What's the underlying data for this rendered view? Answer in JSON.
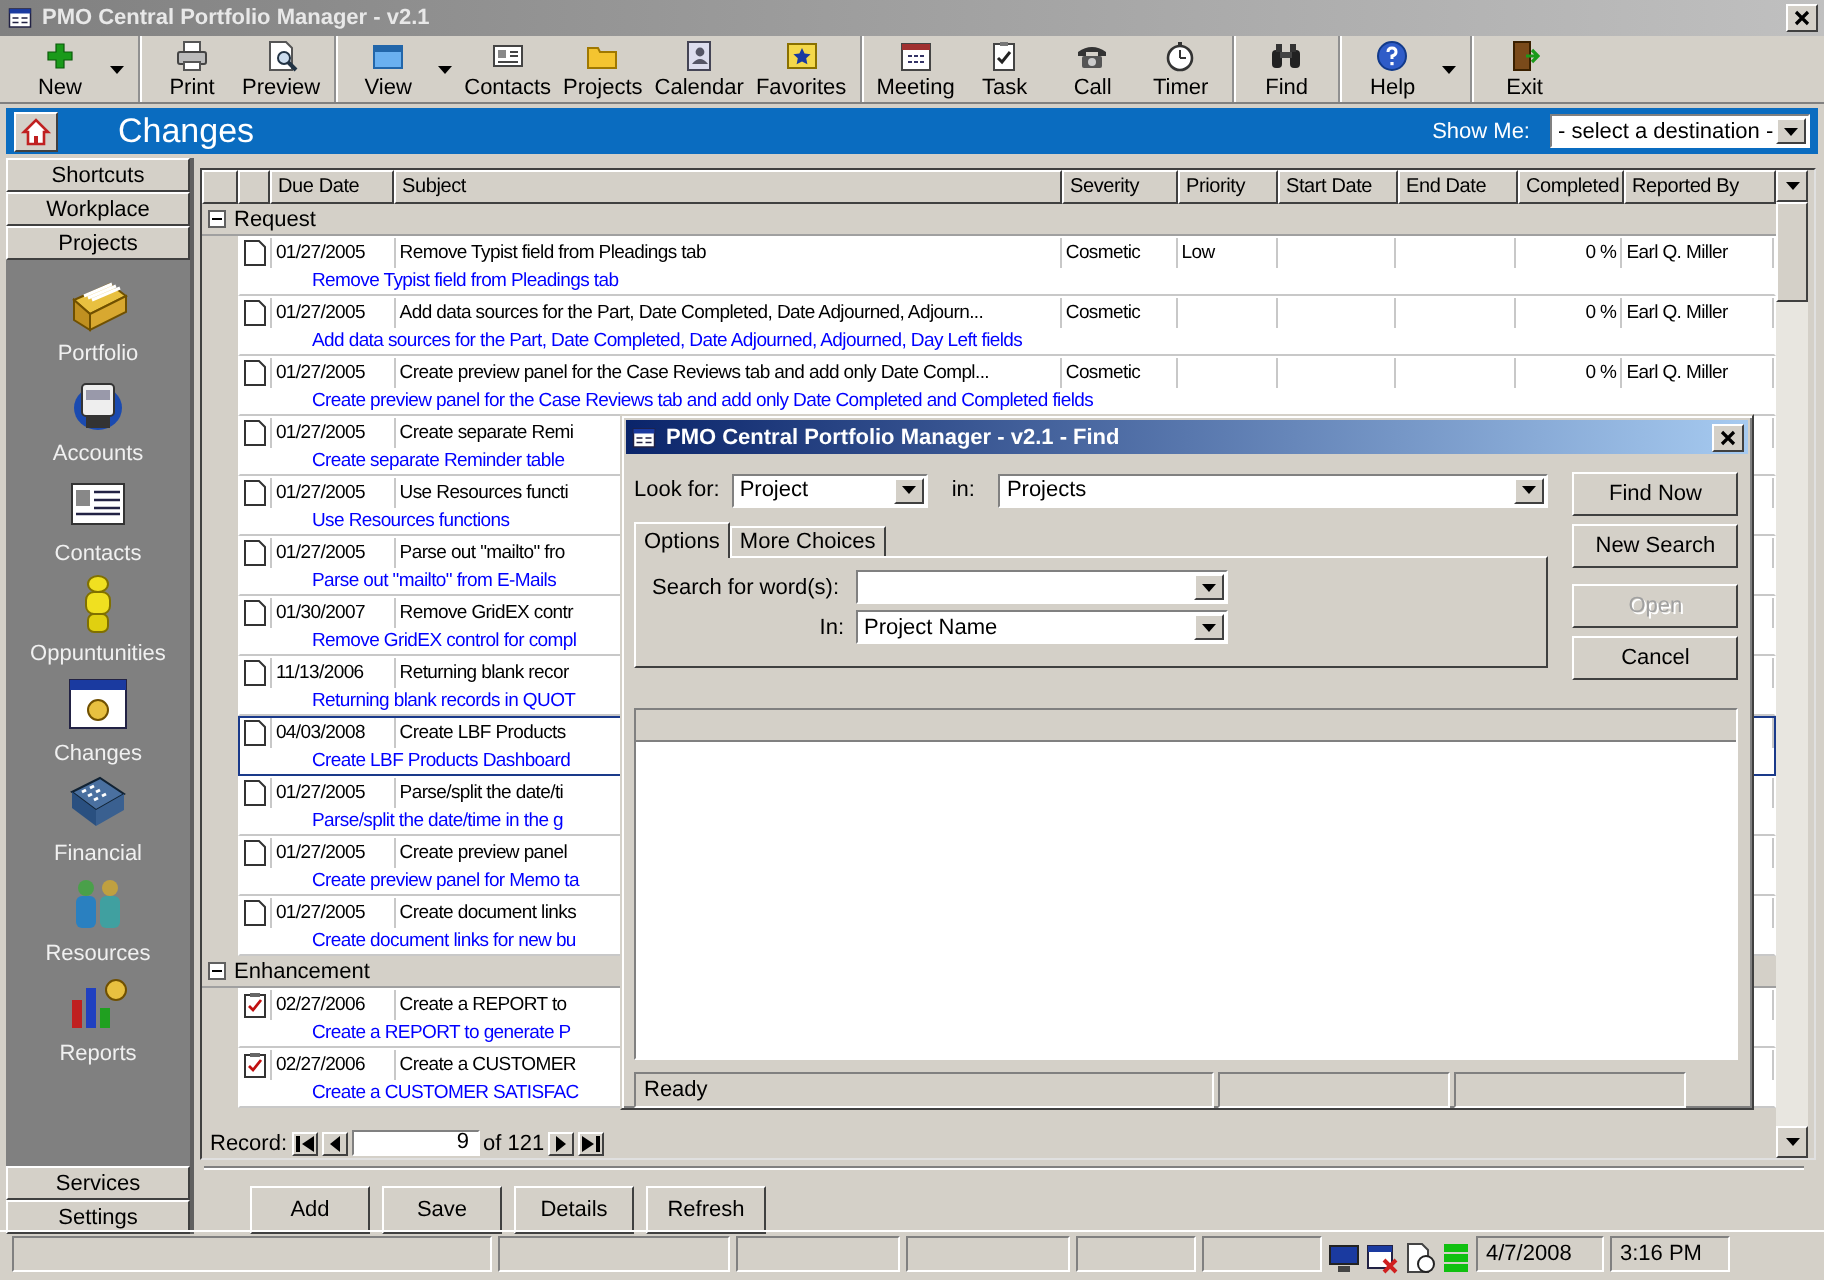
{
  "window": {
    "title": "PMO Central Portfolio Manager - v2.1"
  },
  "toolbar": [
    [
      {
        "label": "New",
        "dropdown": true
      }
    ],
    [
      {
        "label": "Print",
        "dropdown": false
      },
      {
        "label": "Preview",
        "dropdown": false
      }
    ],
    [
      {
        "label": "View",
        "dropdown": true
      },
      {
        "label": "Contacts",
        "dropdown": false
      },
      {
        "label": "Projects",
        "dropdown": false
      },
      {
        "label": "Calendar",
        "dropdown": false
      },
      {
        "label": "Favorites",
        "dropdown": false
      }
    ],
    [
      {
        "label": "Meeting",
        "dropdown": false
      },
      {
        "label": "Task",
        "dropdown": false
      },
      {
        "label": "Call",
        "dropdown": false
      },
      {
        "label": "Timer",
        "dropdown": false
      }
    ],
    [
      {
        "label": "Find",
        "dropdown": false
      }
    ],
    [
      {
        "label": "Help",
        "dropdown": true
      }
    ],
    [
      {
        "label": "Exit",
        "dropdown": false
      }
    ]
  ],
  "header": {
    "title": "Changes",
    "show_me_label": "Show Me:",
    "destination": "- select a destination -"
  },
  "sidebar": {
    "top_buttons": [
      "Shortcuts",
      "Workplace",
      "Projects"
    ],
    "items": [
      "Portfolio",
      "Accounts",
      "Contacts",
      "Oppuntunities",
      "Changes",
      "Financial",
      "Resources",
      "Reports"
    ],
    "bottom_buttons": [
      "Services",
      "Settings"
    ]
  },
  "grid": {
    "columns": [
      "Due Date",
      "Subject",
      "Severity",
      "Priority",
      "Start Date",
      "End Date",
      "Completed",
      "Reported By"
    ],
    "groups": [
      {
        "label": "Request",
        "expanded": true,
        "rows": [
          {
            "kind": "document",
            "selected": false,
            "due": "01/27/2005",
            "subject": "Remove Typist field from Pleadings tab",
            "severity": "Cosmetic",
            "priority": "Low",
            "completed": "0 %",
            "reported_by": "Earl Q. Miller",
            "description": "Remove Typist field from Pleadings tab"
          },
          {
            "kind": "document",
            "selected": false,
            "due": "01/27/2005",
            "subject": "Add data sources for the Part, Date Completed, Date Adjourned, Adjourn...",
            "severity": "Cosmetic",
            "completed": "0 %",
            "reported_by": "Earl Q. Miller",
            "description": "Add data sources for the Part, Date Completed, Date Adjourned, Adjourned, Day Left fields"
          },
          {
            "kind": "document",
            "selected": false,
            "due": "01/27/2005",
            "subject": "Create preview panel for the Case Reviews tab and add only Date Compl...",
            "severity": "Cosmetic",
            "completed": "0 %",
            "reported_by": "Earl Q. Miller",
            "description": "Create preview panel for the Case Reviews tab and add only Date Completed and Completed fields"
          },
          {
            "kind": "document",
            "selected": false,
            "due": "01/27/2005",
            "subject": "Create separate Remi",
            "description": "Create separate Reminder table"
          },
          {
            "kind": "document",
            "selected": false,
            "due": "01/27/2005",
            "subject": "Use Resources functi",
            "description": "Use Resources functions"
          },
          {
            "kind": "document",
            "selected": false,
            "due": "01/27/2005",
            "subject": "Parse out \"mailto\" fro",
            "description": "Parse out \"mailto\" from E-Mails"
          },
          {
            "kind": "document",
            "selected": false,
            "due": "01/30/2007",
            "subject": "Remove GridEX contr",
            "description": "Remove GridEX control for compl"
          },
          {
            "kind": "document",
            "selected": false,
            "due": "11/13/2006",
            "subject": "Returning blank recor",
            "description": "Returning blank records in QUOT"
          },
          {
            "kind": "document",
            "selected": true,
            "due": "04/03/2008",
            "subject": "Create LBF Products",
            "description": "Create LBF Products Dashboard"
          },
          {
            "kind": "document",
            "selected": false,
            "due": "01/27/2005",
            "subject": "Parse/split the date/ti",
            "description": "Parse/split the date/time in the g"
          },
          {
            "kind": "document",
            "selected": false,
            "due": "01/27/2005",
            "subject": "Create preview panel",
            "description": "Create preview panel for Memo ta"
          },
          {
            "kind": "document",
            "selected": false,
            "due": "01/27/2005",
            "subject": "Create document links",
            "description": "Create document links for new bu"
          }
        ]
      },
      {
        "label": "Enhancement",
        "expanded": true,
        "rows": [
          {
            "kind": "checklist",
            "selected": false,
            "due": "02/27/2006",
            "subject": "Create a REPORT to",
            "description": "Create a REPORT to generate P"
          },
          {
            "kind": "checklist",
            "selected": false,
            "due": "02/27/2006",
            "subject": "Create a CUSTOMER",
            "description": "Create a CUSTOMER SATISFAC"
          }
        ]
      }
    ]
  },
  "record_nav": {
    "label": "Record:",
    "current": "9",
    "total": "of 121"
  },
  "actions": [
    "Add",
    "Save",
    "Details",
    "Refresh"
  ],
  "find_dialog": {
    "title": "PMO Central Portfolio Manager - v2.1 - Find",
    "look_for_label": "Look for:",
    "look_for": "Project",
    "in_label": "in:",
    "in": "Projects",
    "tabs": [
      {
        "label": "Options",
        "selected": true
      },
      {
        "label": "More Choices",
        "selected": false
      }
    ],
    "search_label": "Search for word(s):",
    "search_in_label": "In:",
    "search_in": "Project Name",
    "buttons": [
      {
        "label": "Find Now",
        "disabled": false
      },
      {
        "label": "New Search",
        "disabled": false
      },
      {
        "label": "Open",
        "disabled": true
      },
      {
        "label": "Cancel",
        "disabled": false
      }
    ],
    "status": "Ready"
  },
  "status_bar": {
    "date": "4/7/2008",
    "time": "3:16 PM"
  }
}
